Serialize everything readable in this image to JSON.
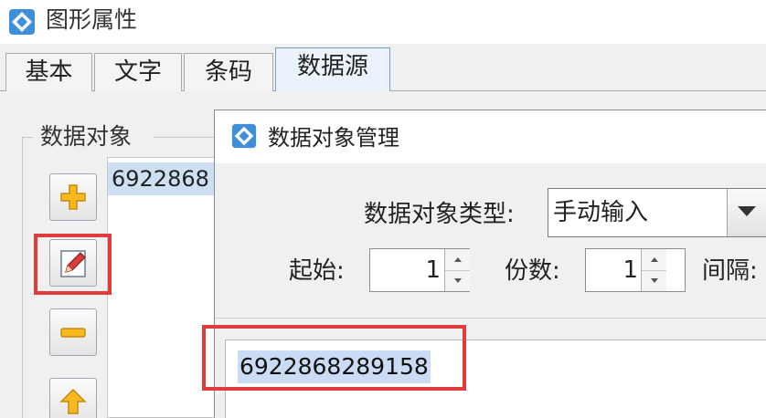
{
  "window": {
    "title": "图形属性",
    "tabs": [
      {
        "label": "基本"
      },
      {
        "label": "文字"
      },
      {
        "label": "条码"
      },
      {
        "label": "数据源"
      }
    ],
    "active_tab": "数据源"
  },
  "data_source_panel": {
    "group_title": "数据对象",
    "list_items": [
      "6922868"
    ],
    "side_buttons": [
      "plus-icon",
      "edit-icon",
      "minus-icon",
      "arrow-up-icon"
    ]
  },
  "dialog": {
    "title": "数据对象管理",
    "type_label": "数据对象类型:",
    "type_value": "手动输入",
    "start_label": "起始:",
    "start_value": "1",
    "copies_label": "份数:",
    "copies_value": "1",
    "interval_label": "间隔:",
    "content_value": "6922868289158"
  },
  "colors": {
    "highlight_box": "#e23b3b",
    "selection": "#c9dcf3",
    "active_tab": "#eaf3fb"
  }
}
